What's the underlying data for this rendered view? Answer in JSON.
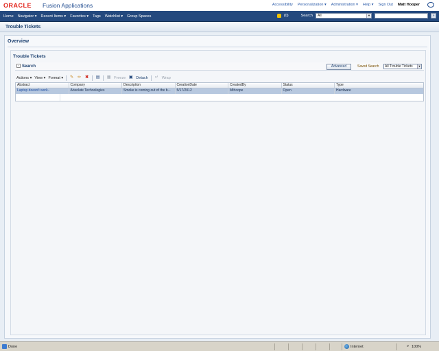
{
  "header": {
    "logo": "ORACLE",
    "product": "Fusion Applications",
    "links": [
      "Accessibility",
      "Personalization ▾",
      "Administration ▾",
      "Help ▾",
      "Sign Out"
    ],
    "user": "Matt Hooper"
  },
  "nav": {
    "items": [
      "Home",
      "Navigator ▾",
      "Recent Items ▾",
      "Favorites ▾",
      "Tags",
      "Watchlist ▾",
      "Group Spaces"
    ],
    "notification_count": "(0)",
    "search_label": "Search",
    "search_scope": "All"
  },
  "page": {
    "title": "Trouble Tickets",
    "overview_title": "Overview",
    "panel_title": "Trouble Tickets"
  },
  "search": {
    "label": "Search",
    "advanced": "Advanced",
    "saved_label": "Saved Search",
    "saved_value": "All Trouble Tickets"
  },
  "toolbar": {
    "actions": "Actions ▾",
    "view": "View ▾",
    "format": "Format ▾",
    "freeze": "Freeze",
    "detach": "Detach",
    "wrap": "Wrap"
  },
  "table": {
    "columns": [
      "Abstract",
      "Company",
      "Description",
      "CreationDate",
      "CreatedBy",
      "Status",
      "Type"
    ],
    "rows": [
      [
        "Laptop doesn't work..",
        "Absolute Technologies",
        "Smoke is coming out of the b...",
        "5/17/2012",
        "Mthoope",
        "Open",
        "Hardware"
      ]
    ]
  },
  "statusbar": {
    "status": "Done",
    "zone": "Internet",
    "zoom": "100%"
  }
}
